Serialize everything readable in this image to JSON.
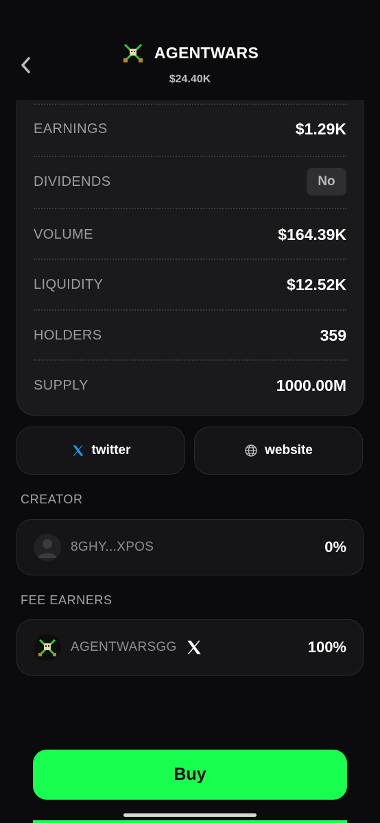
{
  "header": {
    "token_name": "AGENTWARS",
    "price": "$24.40K",
    "back_icon": "chevron-left-icon",
    "logo_icon": "crossed-swords-skull-icon"
  },
  "stats": [
    {
      "key": "earnings",
      "label": "EARNINGS",
      "value": "$1.29K"
    },
    {
      "key": "dividends",
      "label": "DIVIDENDS",
      "value": "No"
    },
    {
      "key": "volume",
      "label": "VOLUME",
      "value": "$164.39K"
    },
    {
      "key": "liquidity",
      "label": "LIQUIDITY",
      "value": "$12.52K"
    },
    {
      "key": "holders",
      "label": "HOLDERS",
      "value": "359"
    },
    {
      "key": "supply",
      "label": "SUPPLY",
      "value": "1000.00M"
    }
  ],
  "links": {
    "twitter": {
      "label": "twitter",
      "icon": "x-logo-icon"
    },
    "website": {
      "label": "website",
      "icon": "globe-icon"
    }
  },
  "creator": {
    "title": "CREATOR",
    "name": "8GHY...XPOS",
    "percent": "0%",
    "avatar_icon": "user-silhouette-icon"
  },
  "fee_earners": {
    "title": "FEE EARNERS",
    "name": "AGENTWARSGG",
    "percent": "100%",
    "platform_icon": "x-logo-icon"
  },
  "actions": {
    "buy_label": "Buy"
  },
  "colors": {
    "background": "#0b0b0d",
    "card": "#1a1a1c",
    "accent_green": "#19ff4f",
    "twitter_blue": "#1d9bf0"
  }
}
